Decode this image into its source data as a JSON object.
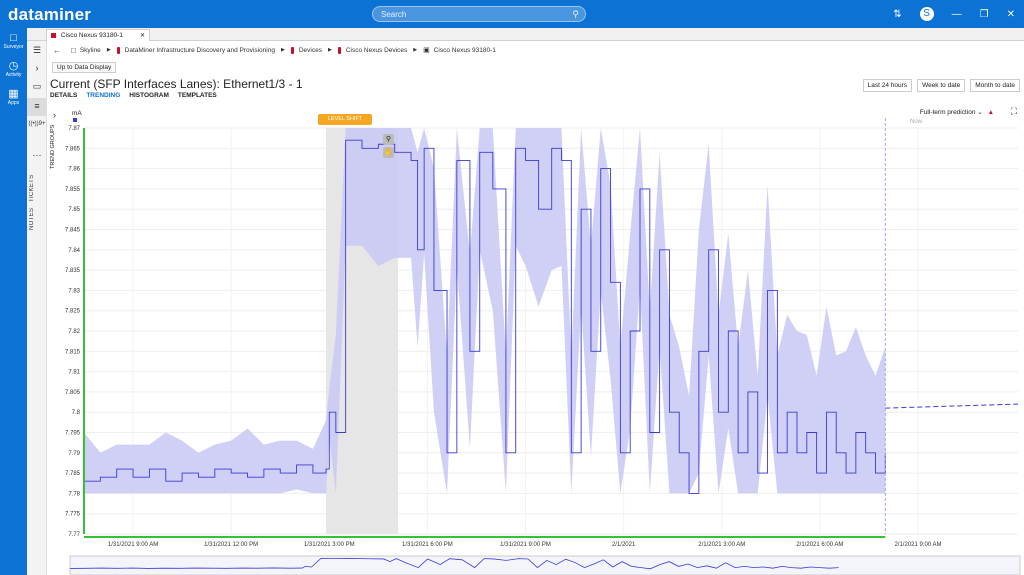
{
  "app": {
    "logo": "dataminer"
  },
  "search": {
    "placeholder": "Search"
  },
  "user": {
    "initial": "S"
  },
  "leftnav": [
    {
      "icon": "surveyor-icon",
      "label": "Surveyor"
    },
    {
      "icon": "activity-icon",
      "label": "Activity"
    },
    {
      "icon": "apps-icon",
      "label": "Apps"
    }
  ],
  "tab": {
    "label": "Cisco Nexus 93180-1"
  },
  "breadcrumb": {
    "items": [
      "Skyline",
      "DataMiner Infrastructure Discovery and Provisioning",
      "Devices",
      "Cisco Nexus Devices",
      "Cisco Nexus 93180-1"
    ]
  },
  "up_to_data_display": "Up to Data Display",
  "title": "Current (SFP Interfaces Lanes): Ethernet1/3 - 1",
  "views": [
    "DETAILS",
    "TRENDING",
    "HISTOGRAM",
    "TEMPLATES"
  ],
  "active_view": "TRENDING",
  "range_buttons": [
    "Last 24 hours",
    "Week to date",
    "Month to date"
  ],
  "prediction": {
    "label": "Full-term prediction"
  },
  "sidebar": {
    "tickets": "TICKETS",
    "notes": "NOTES",
    "badge": "9+"
  },
  "chart": {
    "trend_groups_label": "TREND GROUPS",
    "level_shift": "LEVEL SHIFT",
    "now_label": "Now"
  },
  "chart_data": {
    "type": "line",
    "unit": "mA",
    "ylim": [
      7.77,
      7.87
    ],
    "y_ticks": [
      "7.87",
      "7.865",
      "7.86",
      "7.855",
      "7.85",
      "7.845",
      "7.84",
      "7.835",
      "7.83",
      "7.825",
      "7.82",
      "7.815",
      "7.81",
      "7.805",
      "7.8",
      "7.795",
      "7.79",
      "7.785",
      "7.78",
      "7.775",
      "7.77"
    ],
    "x_ticks": [
      "1/31/2021 9:00 AM",
      "1/31/2021 12:00 PM",
      "1/31/2021 3:00 PM",
      "1/31/2021 6:00 PM",
      "1/31/2021 9:00 PM",
      "2/1/2021",
      "2/1/2021 3:00 AM",
      "2/1/2021 6:00 AM",
      "2/1/2021 9:00 AM"
    ],
    "x_range_hours": [
      7.5,
      33
    ],
    "series": [
      {
        "kind": "average",
        "color": "#3a3ad6",
        "points": [
          [
            7.5,
            7.783
          ],
          [
            8.0,
            7.784
          ],
          [
            8.5,
            7.786
          ],
          [
            9.0,
            7.784
          ],
          [
            9.5,
            7.786
          ],
          [
            10.0,
            7.783
          ],
          [
            10.5,
            7.785
          ],
          [
            11.0,
            7.784
          ],
          [
            11.5,
            7.786
          ],
          [
            12.0,
            7.785
          ],
          [
            12.5,
            7.784
          ],
          [
            13.0,
            7.786
          ],
          [
            13.5,
            7.785
          ],
          [
            14.0,
            7.787
          ],
          [
            14.5,
            7.785
          ],
          [
            14.9,
            7.786
          ],
          [
            15.0,
            7.8
          ],
          [
            15.2,
            7.795
          ],
          [
            15.5,
            7.867
          ],
          [
            16.0,
            7.865
          ],
          [
            16.5,
            7.866
          ],
          [
            17.0,
            7.864
          ],
          [
            17.5,
            7.862
          ],
          [
            17.7,
            7.84
          ],
          [
            17.9,
            7.865
          ],
          [
            18.2,
            7.83
          ],
          [
            18.6,
            7.79
          ],
          [
            18.9,
            7.862
          ],
          [
            19.3,
            7.815
          ],
          [
            19.6,
            7.864
          ],
          [
            20.0,
            7.855
          ],
          [
            20.4,
            7.79
          ],
          [
            20.7,
            7.865
          ],
          [
            21.0,
            7.862
          ],
          [
            21.4,
            7.85
          ],
          [
            21.8,
            7.865
          ],
          [
            22.1,
            7.862
          ],
          [
            22.4,
            7.79
          ],
          [
            22.7,
            7.85
          ],
          [
            23.0,
            7.815
          ],
          [
            23.3,
            7.86
          ],
          [
            23.6,
            7.832
          ],
          [
            23.9,
            7.79
          ],
          [
            24.2,
            7.82
          ],
          [
            24.5,
            7.855
          ],
          [
            24.8,
            7.795
          ],
          [
            25.1,
            7.84
          ],
          [
            25.4,
            7.8
          ],
          [
            25.7,
            7.79
          ],
          [
            26.0,
            7.78
          ],
          [
            26.3,
            7.815
          ],
          [
            26.6,
            7.84
          ],
          [
            26.9,
            7.8
          ],
          [
            27.2,
            7.82
          ],
          [
            27.5,
            7.79
          ],
          [
            27.8,
            7.805
          ],
          [
            28.1,
            7.785
          ],
          [
            28.4,
            7.83
          ],
          [
            28.7,
            7.79
          ],
          [
            29.0,
            7.8
          ],
          [
            29.3,
            7.79
          ],
          [
            29.6,
            7.795
          ],
          [
            29.9,
            7.785
          ],
          [
            30.2,
            7.8
          ],
          [
            30.5,
            7.79
          ],
          [
            30.8,
            7.785
          ],
          [
            31.1,
            7.795
          ],
          [
            31.4,
            7.79
          ],
          [
            31.7,
            7.785
          ],
          [
            32.0,
            7.79
          ]
        ]
      },
      {
        "kind": "prediction",
        "color": "#3a3ad6",
        "points": [
          [
            32.0,
            7.801
          ],
          [
            33.0,
            7.802
          ]
        ]
      }
    ],
    "band": {
      "color": "#c8c8f5",
      "min": 7.78,
      "max": 7.87
    }
  }
}
